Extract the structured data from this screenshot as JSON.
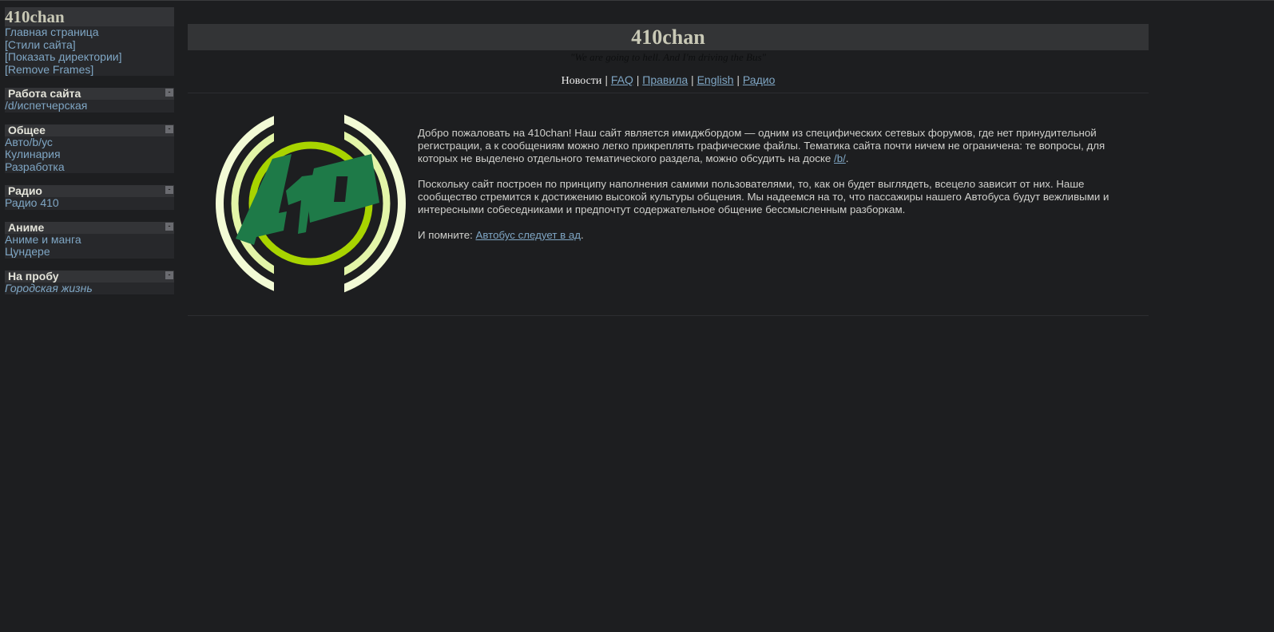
{
  "sidebar": {
    "title": "410chan",
    "top_links": [
      "Главная страница",
      "[Стили сайта]",
      "[Показать директории]",
      "[Remove Frames]"
    ],
    "minimize_label": "-",
    "sections": [
      {
        "title": "Работа сайта",
        "items": [
          "/d/испетчерская"
        ]
      },
      {
        "title": "Общее",
        "items": [
          "Авто/b/ус",
          "Кулинария",
          "Разработка"
        ]
      },
      {
        "title": "Радио",
        "items": [
          "Радио 410"
        ]
      },
      {
        "title": "Аниме",
        "items": [
          "Аниме и манга",
          "Цундере"
        ]
      },
      {
        "title": "На пробу",
        "items": [
          "Городская жизнь"
        ]
      }
    ]
  },
  "header": {
    "title": "410chan",
    "slogan": "\"We are going to hell. And I'm driving the Bus\""
  },
  "nav": {
    "current": "Новости",
    "sep": " | ",
    "links": [
      "FAQ",
      "Правила",
      "English",
      "Радио"
    ]
  },
  "logo": {
    "text": "410",
    "colors": {
      "outer": "#f3fbd6",
      "middle": "#e3f5a8",
      "ring": "#a8d400",
      "digits": "#1e7a48"
    }
  },
  "welcome": {
    "p1": "Добро пожаловать на 410chan! Наш сайт является имиджбордом — одним из специфических сетевых форумов, где нет принудительной регистрации, а к сообщениям можно легко прикреплять графические файлы. Тематика сайта почти ничем не ограничена: те вопросы, для которых не выделено отдельного тематического раздела, можно обсудить на доске ",
    "p1_link": "/b/",
    "p1_end": ".",
    "p2": "Поскольку сайт построен по принципу наполнения самими пользователями, то, как он будет выглядеть, всецело зависит от них. Наше сообщество стремится к достижению высокой культуры общения. Мы надеемся на то, что пассажиры нашего Автобуса будут вежливыми и интересными собеседниками и предпочтут содержательное общение бессмысленным разборкам.",
    "p3": "И помните: ",
    "p3_link": "Автобус следует в ад",
    "p3_end": "."
  }
}
